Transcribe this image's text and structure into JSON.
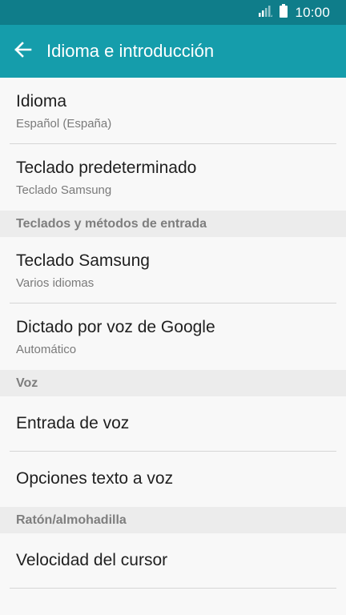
{
  "status_bar": {
    "time": "10:00",
    "signal_icon": "signal-icon",
    "battery_icon": "battery-icon"
  },
  "app_bar": {
    "title": "Idioma e introducción",
    "back_icon": "arrow-left-icon"
  },
  "colors": {
    "status_bar": "#0f7d8a",
    "app_bar": "#159dab",
    "background": "#f8f8f8",
    "section_background": "#ececec"
  },
  "items": {
    "idioma": {
      "title": "Idioma",
      "subtitle": "Español (España)"
    },
    "teclado_predeterminado": {
      "title": "Teclado predeterminado",
      "subtitle": "Teclado Samsung"
    },
    "teclado_samsung": {
      "title": "Teclado Samsung",
      "subtitle": "Varios idiomas"
    },
    "dictado_google": {
      "title": "Dictado por voz de Google",
      "subtitle": "Automático"
    },
    "entrada_voz": {
      "title": "Entrada de voz"
    },
    "opciones_tts": {
      "title": "Opciones texto a voz"
    },
    "velocidad_cursor": {
      "title": "Velocidad del cursor"
    }
  },
  "sections": {
    "teclados": "Teclados y métodos de entrada",
    "voz": "Voz",
    "raton": "Ratón/almohadilla"
  }
}
